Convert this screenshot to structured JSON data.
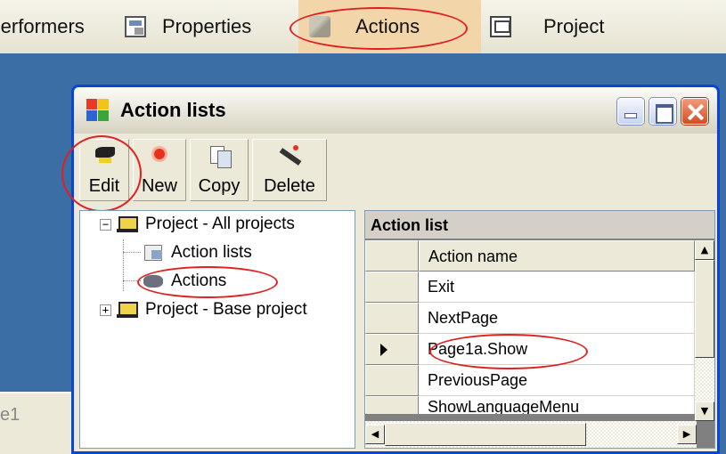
{
  "top_tabs": {
    "performers": "Performers",
    "properties": "Properties",
    "actions": "Actions",
    "project": "Project"
  },
  "status": {
    "text": "e1"
  },
  "window": {
    "title": "Action lists",
    "toolbar": {
      "edit": "Edit",
      "new": "New",
      "copy": "Copy",
      "delete": "Delete"
    },
    "tree": {
      "items": [
        {
          "label": "Project - All projects",
          "expander": "−"
        },
        {
          "label": "Action lists"
        },
        {
          "label": "Actions"
        },
        {
          "label": "Project - Base project",
          "expander": "+"
        }
      ]
    },
    "grid": {
      "caption": "Action list",
      "column_header": "Action name",
      "rows": [
        "Exit",
        "NextPage",
        "Page1a.Show",
        "PreviousPage",
        "ShowLanguageMenu"
      ],
      "selected_row": "Page1a.Show"
    }
  },
  "colors": {
    "highlight_oval": "#e02020",
    "title_border": "#0846d8",
    "active_tab": "#f3d5aa"
  },
  "icons": [
    "properties-icon",
    "actions-icon",
    "project-icon",
    "app-icon",
    "edit-icon",
    "new-icon",
    "copy-icon",
    "delete-icon",
    "project-folder-icon",
    "action-lists-icon",
    "actions-node-icon"
  ]
}
